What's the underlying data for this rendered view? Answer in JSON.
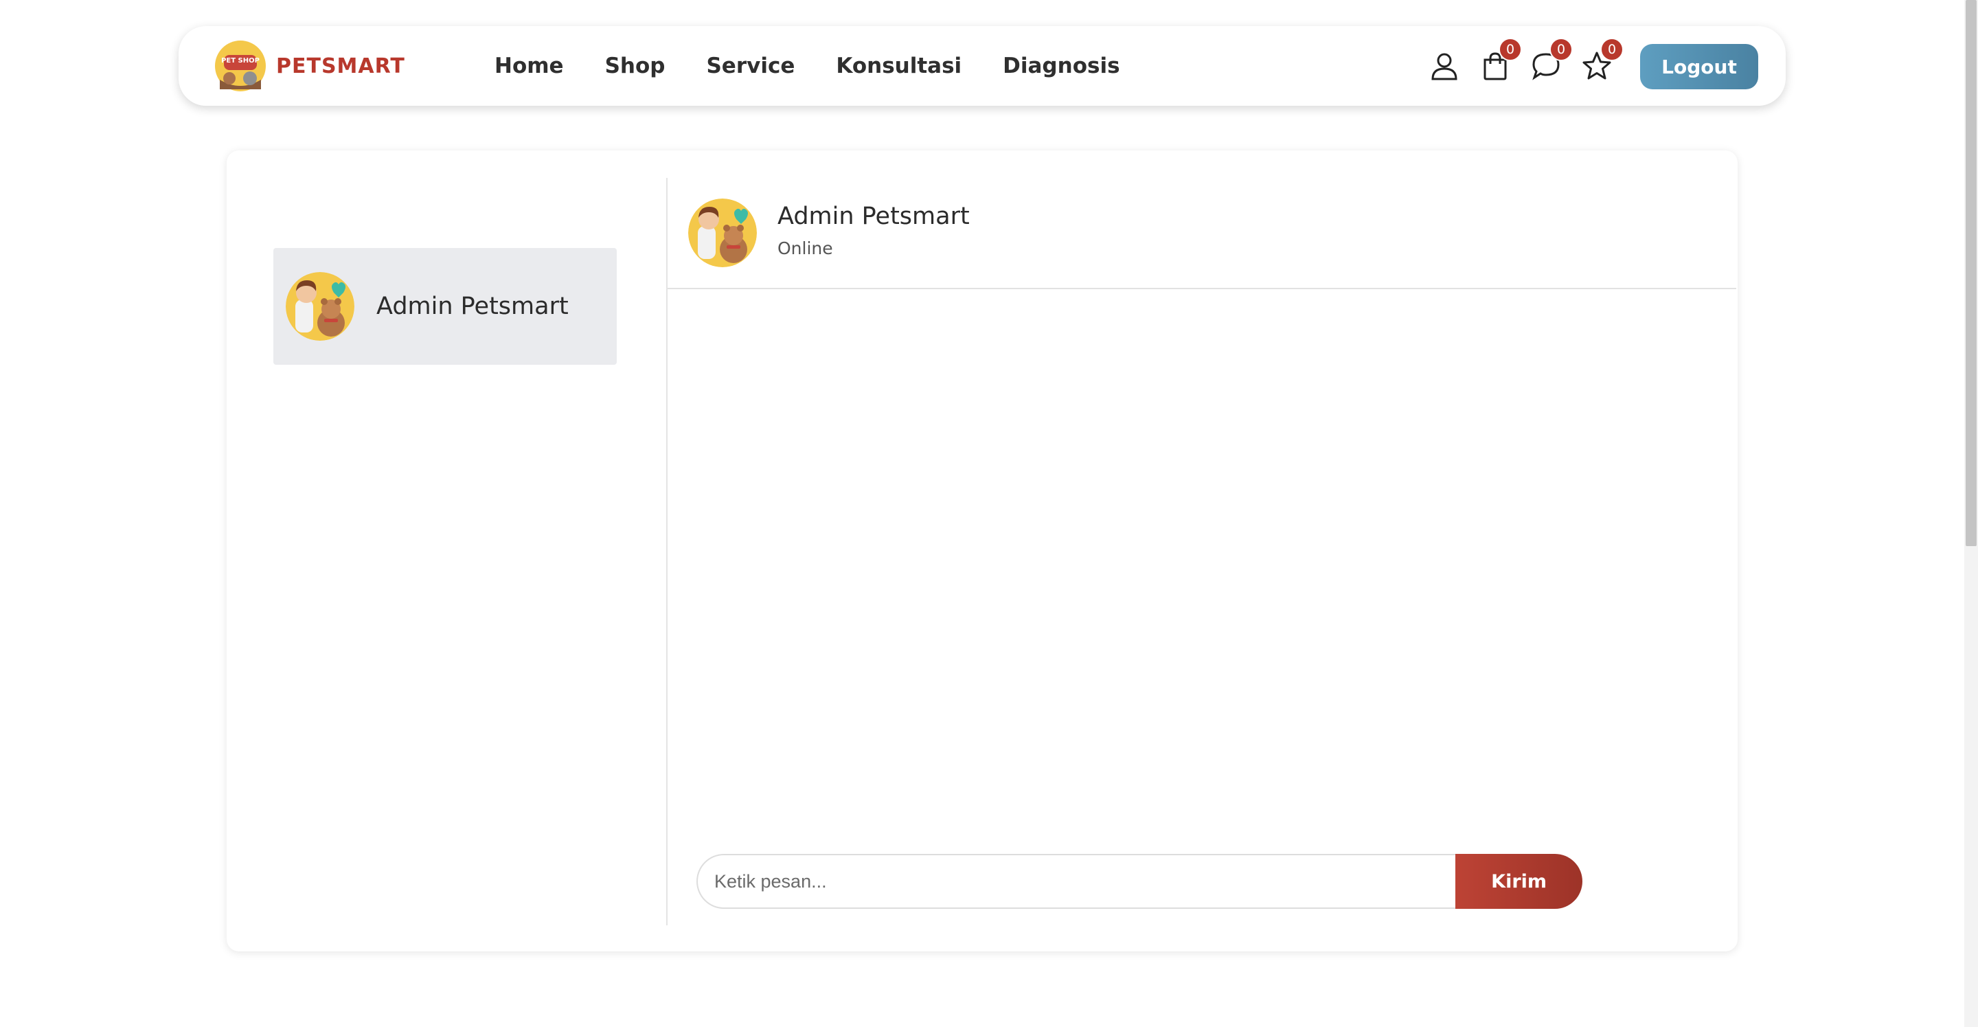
{
  "brand": {
    "logo_text": "PET SHOP",
    "name": "PETSMART"
  },
  "nav": {
    "links": [
      "Home",
      "Shop",
      "Service",
      "Konsultasi",
      "Diagnosis"
    ],
    "icons": {
      "profile": "user-icon",
      "cart": {
        "icon": "shopping-bag-icon",
        "count": "0"
      },
      "chat": {
        "icon": "chat-bubble-icon",
        "count": "0"
      },
      "wishlist": {
        "icon": "star-icon",
        "count": "0"
      }
    },
    "logout_label": "Logout"
  },
  "contacts": [
    {
      "name": "Admin Petsmart"
    }
  ],
  "chat": {
    "title": "Admin Petsmart",
    "status": "Online",
    "input_placeholder": "Ketik pesan...",
    "input_value": "",
    "send_label": "Kirim"
  },
  "colors": {
    "brand_red": "#b8382c",
    "logout_blue": "#5e9ec0",
    "send_red": "#bd4335",
    "badge_red": "#b8382c",
    "selected_contact_bg": "#eaebee"
  }
}
